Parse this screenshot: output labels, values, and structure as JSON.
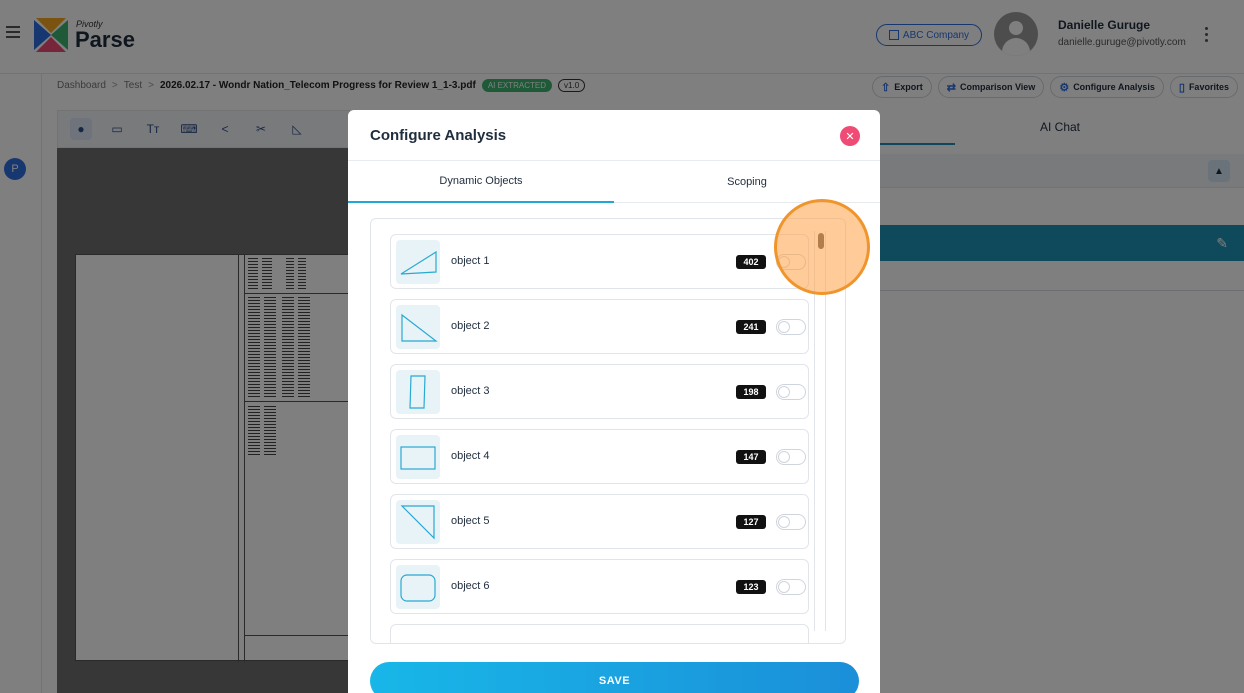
{
  "header": {
    "brand_small": "Pivotly",
    "brand_big": "Parse",
    "company": "ABC Company",
    "user_name": "Danielle Guruge",
    "user_email": "danielle.guruge@pivotly.com"
  },
  "rail": {
    "avatar_letter": "P"
  },
  "breadcrumb": {
    "items": [
      "Dashboard",
      "Test"
    ],
    "file": "2026.02.17 - Wondr Nation_Telecom Progress for Review 1_1-3.pdf",
    "status_badge": "AI EXTRACTED",
    "version": "v1.0"
  },
  "actions": {
    "export": "Export",
    "comparison": "Comparison View",
    "configure": "Configure Analysis",
    "favorites": "Favorites"
  },
  "right_panel": {
    "tab": "AI Chat"
  },
  "modal": {
    "title": "Configure Analysis",
    "tabs": [
      "Dynamic Objects",
      "Scoping"
    ],
    "items": [
      {
        "label": "object 1",
        "count": "402",
        "icon": "parallelogram-shape-icon"
      },
      {
        "label": "object 2",
        "count": "241",
        "icon": "right-triangle-shape-icon"
      },
      {
        "label": "object 3",
        "count": "198",
        "icon": "tall-rectangle-shape-icon"
      },
      {
        "label": "object 4",
        "count": "147",
        "icon": "rectangle-shape-icon"
      },
      {
        "label": "object 5",
        "count": "127",
        "icon": "triangle-shape-icon"
      },
      {
        "label": "object 6",
        "count": "123",
        "icon": "rounded-rectangle-shape-icon"
      }
    ],
    "save_label": "SAVE"
  },
  "colors": {
    "accent": "#1fa7d6",
    "close": "#ef4b74",
    "marker": "#f0942c"
  }
}
